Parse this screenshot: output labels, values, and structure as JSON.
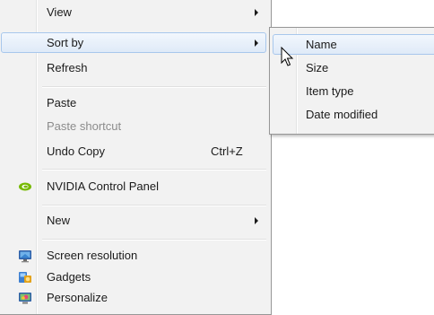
{
  "main_menu": {
    "view_label": "View",
    "sort_by_label": "Sort by",
    "refresh_label": "Refresh",
    "paste_label": "Paste",
    "paste_shortcut_label": "Paste shortcut",
    "undo_copy_label": "Undo Copy",
    "undo_copy_shortcut": "Ctrl+Z",
    "nvidia_label": "NVIDIA Control Panel",
    "new_label": "New",
    "screen_resolution_label": "Screen resolution",
    "gadgets_label": "Gadgets",
    "personalize_label": "Personalize"
  },
  "sort_submenu": {
    "items": [
      {
        "label": "Name"
      },
      {
        "label": "Size"
      },
      {
        "label": "Item type"
      },
      {
        "label": "Date modified"
      }
    ]
  },
  "colors": {
    "menu_bg": "#f2f2f2",
    "hover_border": "#a8c7ec",
    "disabled_text": "#8c8c8c",
    "nvidia_green": "#76b900"
  }
}
